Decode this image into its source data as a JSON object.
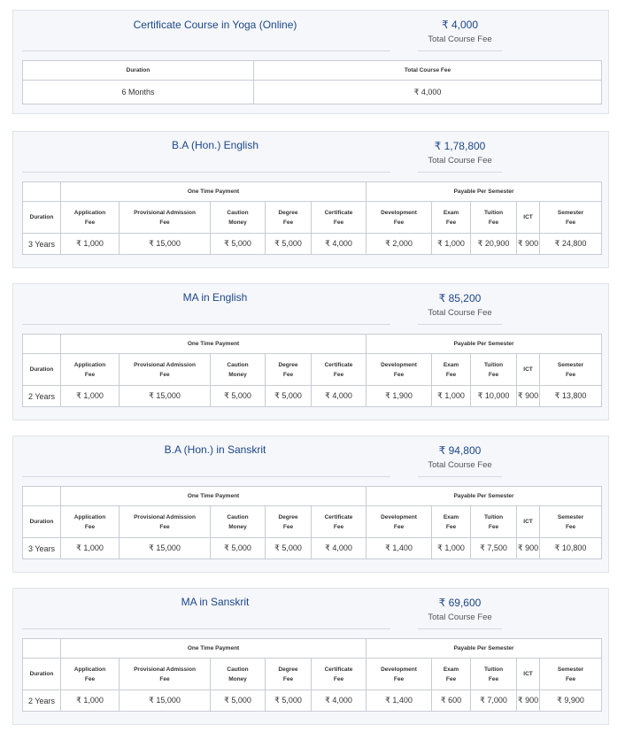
{
  "headers": {
    "duration": "Duration",
    "total_course_fee": "Total Course Fee",
    "one_time_payment": "One Time Payment",
    "payable_per_semester": "Payable Per Semester",
    "application_fee": [
      "Application",
      "Fee"
    ],
    "provisional_admission_fee": [
      "Provisional Admission",
      "Fee"
    ],
    "caution_money": [
      "Caution",
      "Money"
    ],
    "degree_fee": [
      "Degree",
      "Fee"
    ],
    "certificate_fee": [
      "Certificate",
      "Fee"
    ],
    "development_fee": [
      "Development",
      "Fee"
    ],
    "exam_fee": [
      "Exam",
      "Fee"
    ],
    "tuition_fee": [
      "Tuition",
      "Fee"
    ],
    "ict": "ICT",
    "semester_fee": [
      "Semester",
      "Fee"
    ]
  },
  "courses": [
    {
      "title": "Certificate Course in Yoga (Online)",
      "total_fee": "₹ 4,000",
      "total_fee_label": "Total Course Fee",
      "simple": true,
      "duration": "6 Months",
      "table_total_fee": "₹ 4,000"
    },
    {
      "title": "B.A (Hon.) English",
      "total_fee": "₹ 1,78,800",
      "total_fee_label": "Total Course Fee",
      "duration": "3 Years",
      "application_fee": "₹ 1,000",
      "provisional_admission_fee": "₹ 15,000",
      "caution_money": "₹ 5,000",
      "degree_fee": "₹ 5,000",
      "certificate_fee": "₹ 4,000",
      "development_fee": "₹ 2,000",
      "exam_fee": "₹ 1,000",
      "tuition_fee": "₹ 20,900",
      "ict": "₹ 900",
      "semester_fee": "₹ 24,800"
    },
    {
      "title": "MA in English",
      "total_fee": "₹ 85,200",
      "total_fee_label": "Total Course Fee",
      "duration": "2 Years",
      "application_fee": "₹ 1,000",
      "provisional_admission_fee": "₹ 15,000",
      "caution_money": "₹ 5,000",
      "degree_fee": "₹ 5,000",
      "certificate_fee": "₹ 4,000",
      "development_fee": "₹ 1,900",
      "exam_fee": "₹ 1,000",
      "tuition_fee": "₹ 10,000",
      "ict": "₹ 900",
      "semester_fee": "₹ 13,800"
    },
    {
      "title": "B.A (Hon.) in Sanskrit",
      "total_fee": "₹ 94,800",
      "total_fee_label": "Total Course Fee",
      "duration": "3 Years",
      "application_fee": "₹ 1,000",
      "provisional_admission_fee": "₹ 15,000",
      "caution_money": "₹ 5,000",
      "degree_fee": "₹ 5,000",
      "certificate_fee": "₹ 4,000",
      "development_fee": "₹ 1,400",
      "exam_fee": "₹ 1,000",
      "tuition_fee": "₹ 7,500",
      "ict": "₹ 900",
      "semester_fee": "₹ 10,800"
    },
    {
      "title": "MA in Sanskrit",
      "total_fee": "₹ 69,600",
      "total_fee_label": "Total Course Fee",
      "duration": "2 Years",
      "application_fee": "₹ 1,000",
      "provisional_admission_fee": "₹ 15,000",
      "caution_money": "₹ 5,000",
      "degree_fee": "₹ 5,000",
      "certificate_fee": "₹ 4,000",
      "development_fee": "₹ 1,400",
      "exam_fee": "₹ 600",
      "tuition_fee": "₹ 7,000",
      "ict": "₹ 900",
      "semester_fee": "₹ 9,900"
    }
  ]
}
